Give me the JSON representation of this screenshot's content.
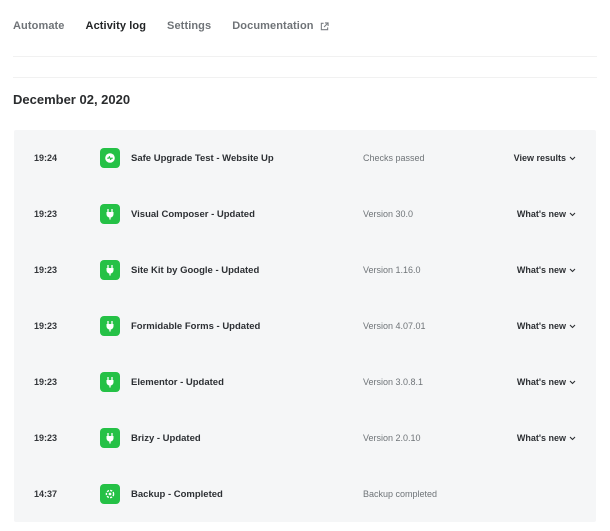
{
  "tabs": [
    {
      "label": "Automate",
      "active": false
    },
    {
      "label": "Activity log",
      "active": true
    },
    {
      "label": "Settings",
      "active": false
    },
    {
      "label": "Documentation",
      "active": false,
      "icon": "external-link-icon"
    }
  ],
  "date_heading": "December 02, 2020",
  "colors": {
    "accent_green": "#25c146",
    "row_bg": "#f5f6f7"
  },
  "log": [
    {
      "time": "19:24",
      "icon": "safe-upgrade-icon",
      "title": "Safe Upgrade Test - Website Up",
      "status": "Checks passed",
      "action": "View results"
    },
    {
      "time": "19:23",
      "icon": "plugin-icon",
      "title": "Visual Composer - Updated",
      "status": "Version 30.0",
      "action": "What's new"
    },
    {
      "time": "19:23",
      "icon": "plugin-icon",
      "title": "Site Kit by Google - Updated",
      "status": "Version 1.16.0",
      "action": "What's new"
    },
    {
      "time": "19:23",
      "icon": "plugin-icon",
      "title": "Formidable Forms - Updated",
      "status": "Version 4.07.01",
      "action": "What's new"
    },
    {
      "time": "19:23",
      "icon": "plugin-icon",
      "title": "Elementor - Updated",
      "status": "Version 3.0.8.1",
      "action": "What's new"
    },
    {
      "time": "19:23",
      "icon": "plugin-icon",
      "title": "Brizy - Updated",
      "status": "Version 2.0.10",
      "action": "What's new"
    },
    {
      "time": "14:37",
      "icon": "backup-icon",
      "title": "Backup - Completed",
      "status": "Backup completed",
      "action": ""
    }
  ]
}
